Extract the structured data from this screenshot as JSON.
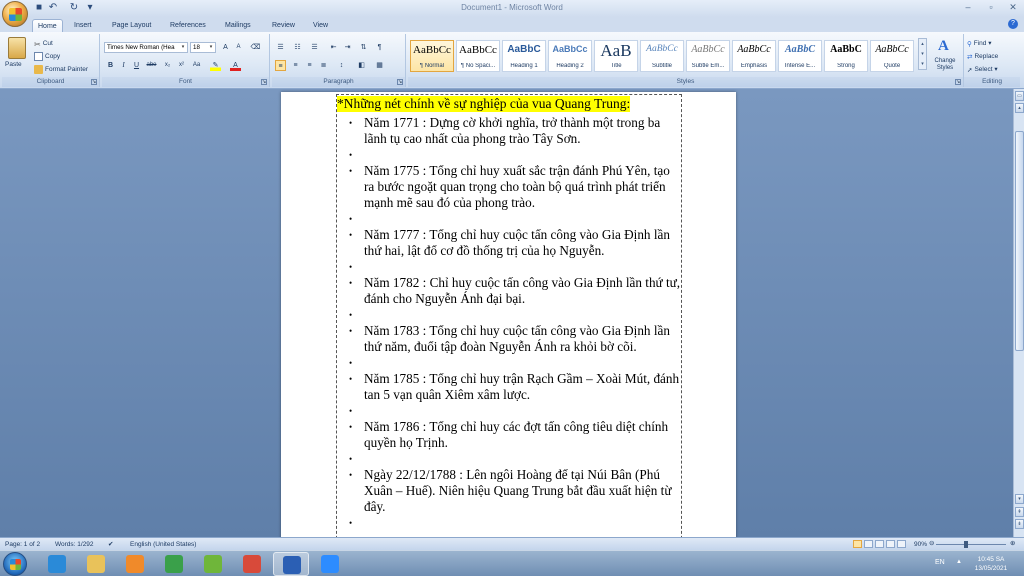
{
  "window": {
    "title": "Document1 - Microsoft Word"
  },
  "tabs": [
    "Home",
    "Insert",
    "Page Layout",
    "References",
    "Mailings",
    "Review",
    "View"
  ],
  "clipboard": {
    "paste": "Paste",
    "cut": "Cut",
    "copy": "Copy",
    "format_painter": "Format Painter",
    "label": "Clipboard"
  },
  "font": {
    "family": "Times New Roman (Hea",
    "size": "18",
    "label": "Font"
  },
  "paragraph": {
    "label": "Paragraph"
  },
  "styles": {
    "label": "Styles",
    "items": [
      {
        "preview": "AaBbCc",
        "name": "¶ Normal",
        "selected": true
      },
      {
        "preview": "AaBbCc",
        "name": "¶ No Spaci..."
      },
      {
        "preview": "AaBbC",
        "name": "Heading 1"
      },
      {
        "preview": "AaBbCc",
        "name": "Heading 2"
      },
      {
        "preview": "AaB",
        "name": "Title"
      },
      {
        "preview": "AaBbCc",
        "name": "Subtitle"
      },
      {
        "preview": "AaBbCc",
        "name": "Subtle Em..."
      },
      {
        "preview": "AaBbCc",
        "name": "Emphasis"
      },
      {
        "preview": "AaBbC",
        "name": "Intense E..."
      },
      {
        "preview": "AaBbC",
        "name": "Strong"
      },
      {
        "preview": "AaBbCc",
        "name": "Quote"
      }
    ],
    "change_styles": "Change Styles"
  },
  "editing": {
    "find": "Find",
    "replace": "Replace",
    "select": "Select",
    "label": "Editing"
  },
  "document": {
    "heading": "*Những nét chính về sự nghiệp của vua Quang Trung:",
    "bullets": [
      "Năm 1771 : Dựng cờ khởi nghĩa, trở thành một trong ba lãnh tụ cao nhất của phong trào Tây Sơn.",
      "",
      "Năm 1775 : Tổng chỉ huy xuất sắc trận đánh Phú Yên, tạo ra bước ngoặt quan trọng cho toàn bộ quá trình phát triển mạnh mẽ sau đó của phong trào.",
      "",
      "Năm 1777 : Tổng chỉ huy cuộc tấn công vào Gia Định lần thứ hai, lật đổ cơ đồ thống trị của họ Nguyễn.",
      "",
      "Năm 1782 : Chỉ huy cuộc tấn công vào Gia Định lần thứ tư, đánh cho Nguyễn Ánh đại bại.",
      "",
      "Năm 1783 : Tổng chỉ huy cuộc tấn công vào Gia Định lần thứ năm, đuổi tập đoàn Nguyễn Ánh ra khỏi bờ cõi.",
      "",
      "Năm 1785 : Tổng chỉ huy trận Rạch Gầm – Xoài Mút, đánh tan 5 vạn quân Xiêm xâm lược.",
      "",
      "Năm 1786 : Tổng chỉ huy các đợt tấn công tiêu diệt chính quyền họ Trịnh.",
      "",
      "Ngày 22/12/1788 : Lên ngôi Hoàng đế tại Núi Bân (Phú Xuân – Huế). Niên hiệu Quang Trung bắt đầu xuất hiện từ đây.",
      ""
    ]
  },
  "status": {
    "page": "Page: 1 of 2",
    "words": "Words: 1/292",
    "language": "English (United States)",
    "zoom": "90%",
    "zoom_fraction": 0.42
  },
  "taskbar": {
    "apps": [
      {
        "icon": "internet-explorer-icon",
        "color": "#2a8ad8"
      },
      {
        "icon": "file-explorer-icon",
        "color": "#e9c25a"
      },
      {
        "icon": "media-player-icon",
        "color": "#f08a2a"
      },
      {
        "icon": "chrome-icon",
        "color": "#3aa04a"
      },
      {
        "icon": "coccoc-icon",
        "color": "#6fb63a"
      },
      {
        "icon": "paint-icon",
        "color": "#d84a3a"
      },
      {
        "icon": "word-icon",
        "color": "#2b5fb4",
        "active": true
      },
      {
        "icon": "zoom-icon",
        "color": "#2d8cff"
      }
    ],
    "language": "EN",
    "time": "10:45 SA",
    "date": "13/05/2021"
  }
}
